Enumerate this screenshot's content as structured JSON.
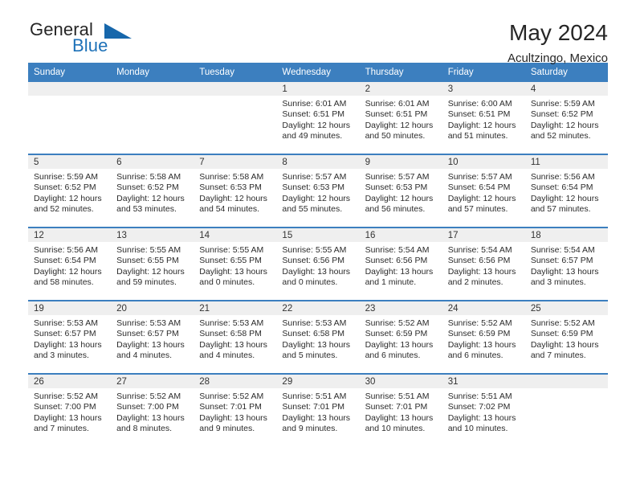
{
  "brand": {
    "name_part1": "General",
    "name_part2": "Blue",
    "triangle_color": "#1767ab",
    "blue_color": "#1d71b8"
  },
  "header": {
    "title": "May 2024",
    "subtitle": "Acultzingo, Mexico"
  },
  "theme": {
    "header_bg": "#3c7fbf",
    "daynum_bg": "#efefef",
    "cell_bg": "#ffffff",
    "text": "#2b2b2b"
  },
  "weekdays": [
    "Sunday",
    "Monday",
    "Tuesday",
    "Wednesday",
    "Thursday",
    "Friday",
    "Saturday"
  ],
  "labels": {
    "sunrise_prefix": "Sunrise: ",
    "sunset_prefix": "Sunset: ",
    "daylight_prefix": "Daylight: "
  },
  "weeks": [
    [
      {
        "empty": true
      },
      {
        "empty": true
      },
      {
        "empty": true
      },
      {
        "day": "1",
        "sunrise": "Sunrise: 6:01 AM",
        "sunset": "Sunset: 6:51 PM",
        "daylight": "Daylight: 12 hours and 49 minutes."
      },
      {
        "day": "2",
        "sunrise": "Sunrise: 6:01 AM",
        "sunset": "Sunset: 6:51 PM",
        "daylight": "Daylight: 12 hours and 50 minutes."
      },
      {
        "day": "3",
        "sunrise": "Sunrise: 6:00 AM",
        "sunset": "Sunset: 6:51 PM",
        "daylight": "Daylight: 12 hours and 51 minutes."
      },
      {
        "day": "4",
        "sunrise": "Sunrise: 5:59 AM",
        "sunset": "Sunset: 6:52 PM",
        "daylight": "Daylight: 12 hours and 52 minutes."
      }
    ],
    [
      {
        "day": "5",
        "sunrise": "Sunrise: 5:59 AM",
        "sunset": "Sunset: 6:52 PM",
        "daylight": "Daylight: 12 hours and 52 minutes."
      },
      {
        "day": "6",
        "sunrise": "Sunrise: 5:58 AM",
        "sunset": "Sunset: 6:52 PM",
        "daylight": "Daylight: 12 hours and 53 minutes."
      },
      {
        "day": "7",
        "sunrise": "Sunrise: 5:58 AM",
        "sunset": "Sunset: 6:53 PM",
        "daylight": "Daylight: 12 hours and 54 minutes."
      },
      {
        "day": "8",
        "sunrise": "Sunrise: 5:57 AM",
        "sunset": "Sunset: 6:53 PM",
        "daylight": "Daylight: 12 hours and 55 minutes."
      },
      {
        "day": "9",
        "sunrise": "Sunrise: 5:57 AM",
        "sunset": "Sunset: 6:53 PM",
        "daylight": "Daylight: 12 hours and 56 minutes."
      },
      {
        "day": "10",
        "sunrise": "Sunrise: 5:57 AM",
        "sunset": "Sunset: 6:54 PM",
        "daylight": "Daylight: 12 hours and 57 minutes."
      },
      {
        "day": "11",
        "sunrise": "Sunrise: 5:56 AM",
        "sunset": "Sunset: 6:54 PM",
        "daylight": "Daylight: 12 hours and 57 minutes."
      }
    ],
    [
      {
        "day": "12",
        "sunrise": "Sunrise: 5:56 AM",
        "sunset": "Sunset: 6:54 PM",
        "daylight": "Daylight: 12 hours and 58 minutes."
      },
      {
        "day": "13",
        "sunrise": "Sunrise: 5:55 AM",
        "sunset": "Sunset: 6:55 PM",
        "daylight": "Daylight: 12 hours and 59 minutes."
      },
      {
        "day": "14",
        "sunrise": "Sunrise: 5:55 AM",
        "sunset": "Sunset: 6:55 PM",
        "daylight": "Daylight: 13 hours and 0 minutes."
      },
      {
        "day": "15",
        "sunrise": "Sunrise: 5:55 AM",
        "sunset": "Sunset: 6:56 PM",
        "daylight": "Daylight: 13 hours and 0 minutes."
      },
      {
        "day": "16",
        "sunrise": "Sunrise: 5:54 AM",
        "sunset": "Sunset: 6:56 PM",
        "daylight": "Daylight: 13 hours and 1 minute."
      },
      {
        "day": "17",
        "sunrise": "Sunrise: 5:54 AM",
        "sunset": "Sunset: 6:56 PM",
        "daylight": "Daylight: 13 hours and 2 minutes."
      },
      {
        "day": "18",
        "sunrise": "Sunrise: 5:54 AM",
        "sunset": "Sunset: 6:57 PM",
        "daylight": "Daylight: 13 hours and 3 minutes."
      }
    ],
    [
      {
        "day": "19",
        "sunrise": "Sunrise: 5:53 AM",
        "sunset": "Sunset: 6:57 PM",
        "daylight": "Daylight: 13 hours and 3 minutes."
      },
      {
        "day": "20",
        "sunrise": "Sunrise: 5:53 AM",
        "sunset": "Sunset: 6:57 PM",
        "daylight": "Daylight: 13 hours and 4 minutes."
      },
      {
        "day": "21",
        "sunrise": "Sunrise: 5:53 AM",
        "sunset": "Sunset: 6:58 PM",
        "daylight": "Daylight: 13 hours and 4 minutes."
      },
      {
        "day": "22",
        "sunrise": "Sunrise: 5:53 AM",
        "sunset": "Sunset: 6:58 PM",
        "daylight": "Daylight: 13 hours and 5 minutes."
      },
      {
        "day": "23",
        "sunrise": "Sunrise: 5:52 AM",
        "sunset": "Sunset: 6:59 PM",
        "daylight": "Daylight: 13 hours and 6 minutes."
      },
      {
        "day": "24",
        "sunrise": "Sunrise: 5:52 AM",
        "sunset": "Sunset: 6:59 PM",
        "daylight": "Daylight: 13 hours and 6 minutes."
      },
      {
        "day": "25",
        "sunrise": "Sunrise: 5:52 AM",
        "sunset": "Sunset: 6:59 PM",
        "daylight": "Daylight: 13 hours and 7 minutes."
      }
    ],
    [
      {
        "day": "26",
        "sunrise": "Sunrise: 5:52 AM",
        "sunset": "Sunset: 7:00 PM",
        "daylight": "Daylight: 13 hours and 7 minutes."
      },
      {
        "day": "27",
        "sunrise": "Sunrise: 5:52 AM",
        "sunset": "Sunset: 7:00 PM",
        "daylight": "Daylight: 13 hours and 8 minutes."
      },
      {
        "day": "28",
        "sunrise": "Sunrise: 5:52 AM",
        "sunset": "Sunset: 7:01 PM",
        "daylight": "Daylight: 13 hours and 9 minutes."
      },
      {
        "day": "29",
        "sunrise": "Sunrise: 5:51 AM",
        "sunset": "Sunset: 7:01 PM",
        "daylight": "Daylight: 13 hours and 9 minutes."
      },
      {
        "day": "30",
        "sunrise": "Sunrise: 5:51 AM",
        "sunset": "Sunset: 7:01 PM",
        "daylight": "Daylight: 13 hours and 10 minutes."
      },
      {
        "day": "31",
        "sunrise": "Sunrise: 5:51 AM",
        "sunset": "Sunset: 7:02 PM",
        "daylight": "Daylight: 13 hours and 10 minutes."
      },
      {
        "empty": true
      }
    ]
  ]
}
